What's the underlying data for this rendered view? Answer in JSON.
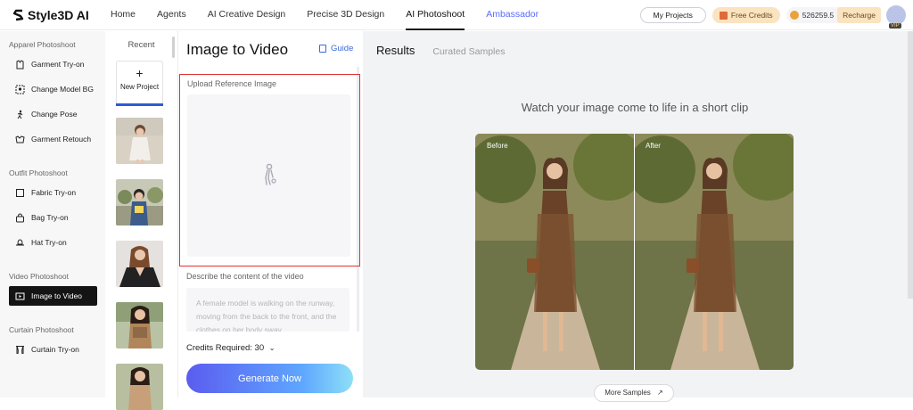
{
  "brand": {
    "name": "Style3D AI"
  },
  "nav": {
    "items": [
      "Home",
      "Agents",
      "AI Creative Design",
      "Precise 3D Design",
      "AI Photoshoot",
      "Ambassador"
    ],
    "active": "AI Photoshoot"
  },
  "header": {
    "my_projects": "My Projects",
    "free_credits": "Free Credits",
    "balance": "526259.5",
    "recharge": "Recharge",
    "vip": "VIP"
  },
  "sidebar": {
    "section_apparel": "Apparel Photoshoot",
    "garment_tryon": "Garment Try-on",
    "change_model_bg": "Change Model BG",
    "change_pose": "Change Pose",
    "garment_retouch": "Garment Retouch",
    "section_outfit": "Outfit Photoshoot",
    "fabric_tryon": "Fabric Try-on",
    "bag_tryon": "Bag Try-on",
    "hat_tryon": "Hat Try-on",
    "section_video": "Video Photoshoot",
    "image_to_video": "Image to Video",
    "section_curtain": "Curtain Photoshoot",
    "curtain_tryon": "Curtain Try-on"
  },
  "recent": {
    "title": "Recent",
    "new_project": "New Project"
  },
  "form": {
    "title": "Image to Video",
    "guide": "Guide",
    "upload_label": "Upload Reference Image",
    "describe_label": "Describe the content of the video",
    "describe_placeholder": "A female model is walking on the runway, moving from the back to the front, and the clothes on her body sway",
    "credits_required": "Credits Required: 30",
    "generate": "Generate Now"
  },
  "results": {
    "tab_results": "Results",
    "tab_curated": "Curated Samples",
    "heading": "Watch your image come to life in a short clip",
    "before": "Before",
    "after": "After",
    "more_samples": "More Samples"
  },
  "colors": {
    "accent": "#5a6bff",
    "highlight": "#dd3333",
    "active_bg": "#141414"
  }
}
